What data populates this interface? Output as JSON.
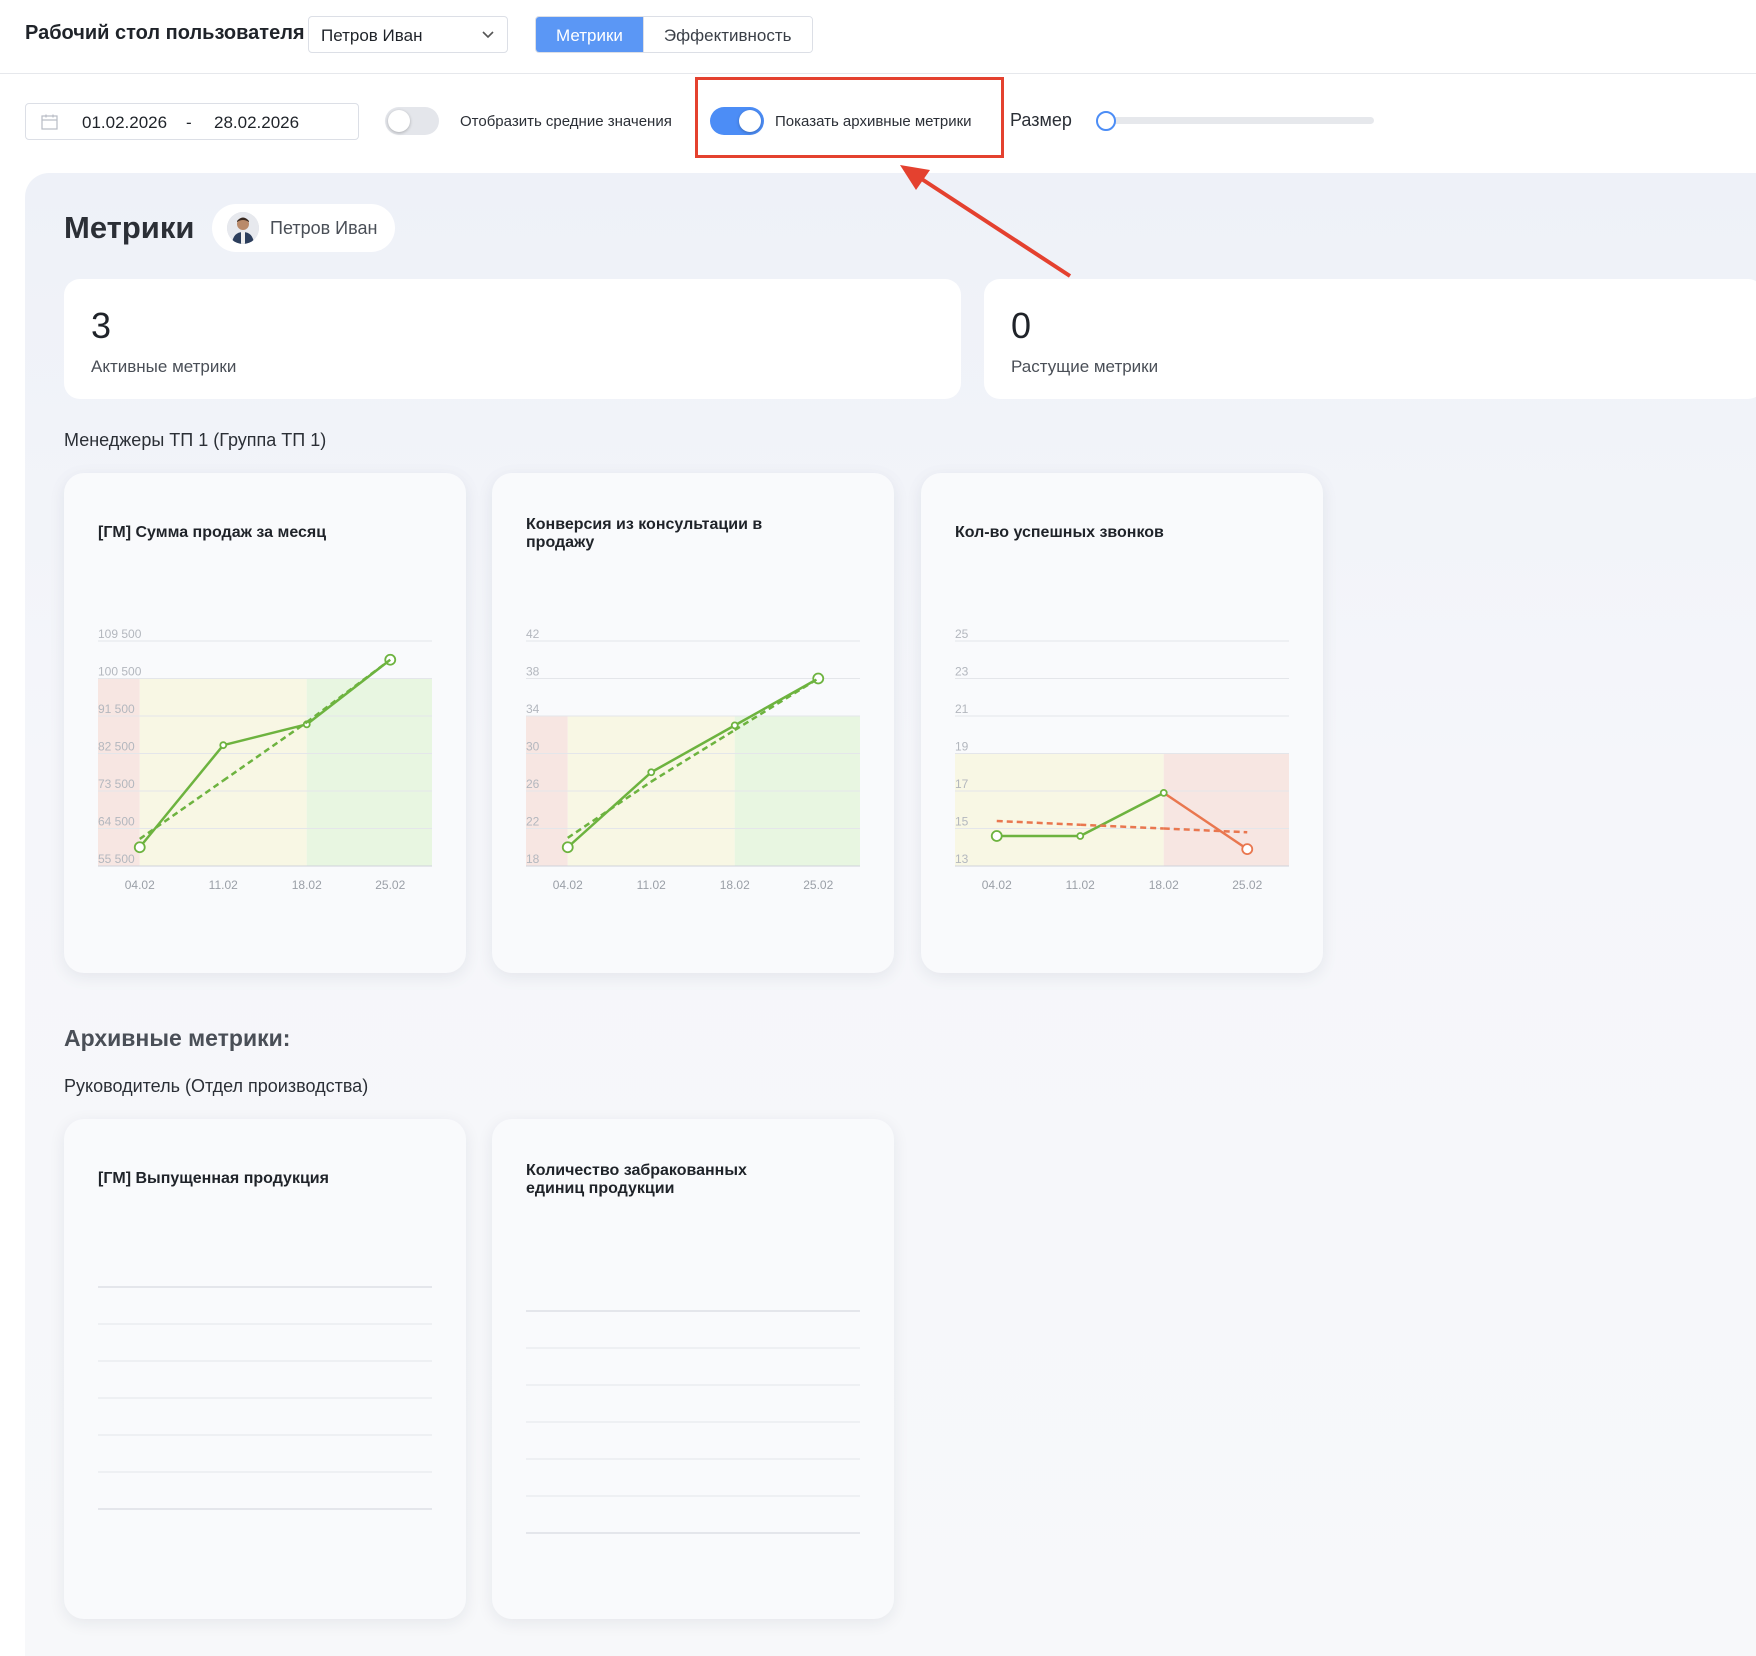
{
  "header": {
    "title": "Рабочий стол пользователя",
    "user_select": "Петров Иван",
    "tabs": [
      {
        "label": "Метрики",
        "active": true
      },
      {
        "label": "Эффективность",
        "active": false
      }
    ]
  },
  "filters": {
    "date_from": "01.02.2026",
    "date_separator": "-",
    "date_to": "28.02.2026",
    "show_averages": {
      "label": "Отобразить средние значения",
      "on": false
    },
    "show_archived": {
      "label": "Показать архивные метрики",
      "on": true
    },
    "size_label": "Размер",
    "size_value": 0
  },
  "panel": {
    "title": "Метрики",
    "user_chip": "Петров Иван",
    "stats": [
      {
        "value": "3",
        "label": "Активные метрики"
      },
      {
        "value": "0",
        "label": "Растущие метрики"
      }
    ],
    "group_title": "Менеджеры ТП 1 (Группа ТП 1)",
    "archive_title": "Архивные метрики:",
    "archive_group_title": "Руководитель (Отдел производства)"
  },
  "colors": {
    "accent": "#4c8df6",
    "good_line": "#6db33f",
    "bad_line": "#e9774f",
    "zone_red": "#f7e6e2",
    "zone_yellow": "#f8f7e4",
    "zone_green": "#e8f6e1",
    "annotation": "#e4412f"
  },
  "chart_data": [
    {
      "type": "line",
      "title": "[ГМ] Сумма продаж за месяц",
      "categories": [
        "04.02",
        "11.02",
        "18.02",
        "25.02"
      ],
      "y_ticks": [
        "109 500",
        "100 500",
        "91 500",
        "82 500",
        "73 500",
        "64 500",
        "55 500"
      ],
      "ylim": [
        55500,
        109500
      ],
      "series": [
        {
          "style": "solid",
          "values": [
            60000,
            84500,
            89500,
            105000
          ]
        },
        {
          "style": "dashed",
          "values": [
            62000,
            76000,
            90000,
            105000
          ]
        }
      ],
      "zones": [
        {
          "from_x": 0,
          "to_x": 0.5,
          "color": "red"
        },
        {
          "from_x": 0.5,
          "to_x": 2.5,
          "color": "yellow"
        },
        {
          "from_x": 2.5,
          "to_x": 3.5,
          "color": "green"
        }
      ],
      "zone_ymax": 100500
    },
    {
      "type": "line",
      "title": "Конверсия из консультации в продажу",
      "categories": [
        "04.02",
        "11.02",
        "18.02",
        "25.02"
      ],
      "y_ticks": [
        "42",
        "38",
        "34",
        "30",
        "26",
        "22",
        "18"
      ],
      "ylim": [
        18,
        42
      ],
      "series": [
        {
          "style": "solid",
          "values": [
            20,
            28,
            33,
            38
          ]
        },
        {
          "style": "dashed",
          "values": [
            21,
            27,
            32.5,
            38
          ]
        }
      ],
      "zones": [
        {
          "from_x": 0,
          "to_x": 0.5,
          "color": "red"
        },
        {
          "from_x": 0.5,
          "to_x": 2.5,
          "color": "yellow"
        },
        {
          "from_x": 2.5,
          "to_x": 3.5,
          "color": "green"
        }
      ],
      "zone_ymax": 34
    },
    {
      "type": "line",
      "title": "Кол-во успешных звонков",
      "categories": [
        "04.02",
        "11.02",
        "18.02",
        "25.02"
      ],
      "y_ticks": [
        "25",
        "23",
        "21",
        "19",
        "17",
        "15",
        "13"
      ],
      "ylim": [
        13,
        25
      ],
      "series": [
        {
          "style": "solid",
          "values": [
            14.6,
            14.6,
            16.9,
            13.9
          ]
        },
        {
          "style": "dashed",
          "values": [
            15.4,
            15.2,
            15.0,
            14.8
          ]
        }
      ],
      "zones": [
        {
          "from_x": 0,
          "to_x": 2.5,
          "color": "yellow"
        },
        {
          "from_x": 2.5,
          "to_x": 3.5,
          "color": "red"
        }
      ],
      "zone_ymax": 19
    }
  ],
  "archive_cards": [
    {
      "title": "[ГМ] Выпущенная продукция"
    },
    {
      "title": "Количество забракованных единиц продукции"
    }
  ]
}
